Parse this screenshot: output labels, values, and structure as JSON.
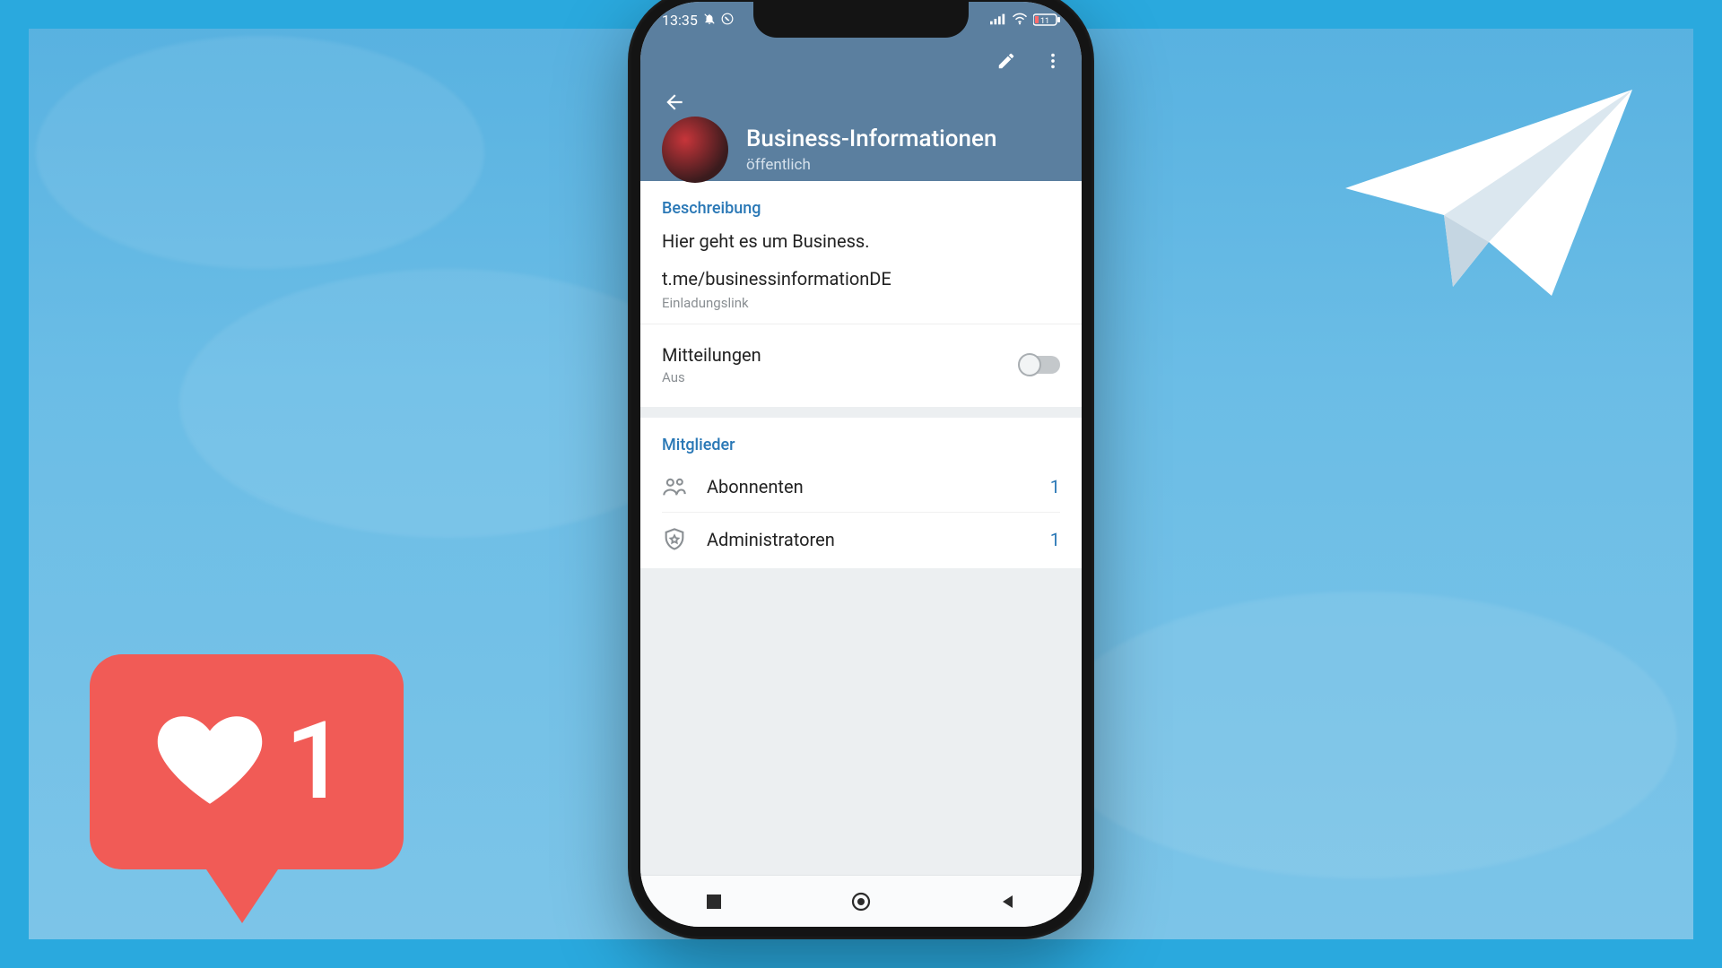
{
  "status": {
    "time": "13:35",
    "battery": "11"
  },
  "header": {
    "title": "Business-Informationen",
    "subtitle": "öffentlich"
  },
  "description": {
    "section_title": "Beschreibung",
    "text": "Hier geht es um Business.",
    "invite_link": "t.me/businessinformationDE",
    "invite_caption": "Einladungslink"
  },
  "notifications": {
    "label": "Mitteilungen",
    "state_label": "Aus",
    "enabled": false
  },
  "members": {
    "section_title": "Mitglieder",
    "subscribers_label": "Abonnenten",
    "subscribers_count": "1",
    "admins_label": "Administratoren",
    "admins_count": "1"
  },
  "like_overlay": {
    "count": "1"
  }
}
